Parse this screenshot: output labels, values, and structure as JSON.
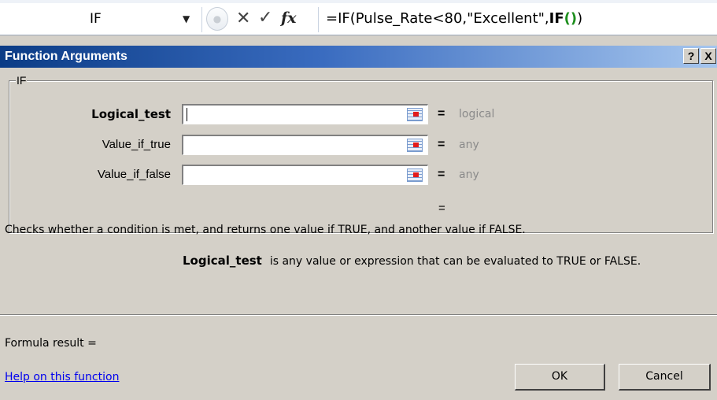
{
  "formula_bar": {
    "name_box": "IF",
    "cancel_icon": "x-icon",
    "enter_icon": "check-icon",
    "fx_label": "fx",
    "formula_prefix": "=IF(Pulse_Rate<80,\"Excellent\",",
    "formula_func": "IF",
    "formula_inner_open": "(",
    "formula_inner_close": ")",
    "formula_suffix": ")"
  },
  "dialog": {
    "title": "Function Arguments",
    "help_button": "?",
    "close_button": "X",
    "group_label": "IF",
    "arguments": [
      {
        "label": "Logical_test",
        "value": "",
        "result": "logical"
      },
      {
        "label": "Value_if_true",
        "value": "",
        "result": "any"
      },
      {
        "label": "Value_if_false",
        "value": "",
        "result": "any"
      }
    ],
    "equals": "=",
    "overall_result": "=",
    "description": "Checks whether a condition is met, and returns one value if TRUE, and another value if FALSE.",
    "arg_help_name": "Logical_test",
    "arg_help_text": "is any value or expression that can be evaluated to TRUE or FALSE.",
    "formula_result": "Formula result =",
    "help_link": "Help on this function",
    "ok_label": "OK",
    "cancel_label": "Cancel"
  }
}
